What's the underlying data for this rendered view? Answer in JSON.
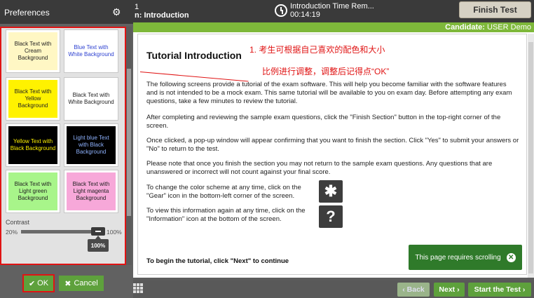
{
  "topbar": {
    "section_num": "1",
    "section_label": "n: Introduction",
    "timer_label": "Introduction Time Rem...",
    "timer_value": "00:14:19",
    "finish_label": "Finish Test"
  },
  "candidate": {
    "label": "Candidate:",
    "name": "USER Demo"
  },
  "main": {
    "title": "Tutorial Introduction",
    "p1": "The following screens provide a tutorial of the exam software. This will help you become familiar with the software features and is not intended to be a mock exam. This same tutorial will be available to you on exam day. Before attempting any exam questions, take a few minutes to review the tutorial.",
    "p2": "After completing and reviewing the sample exam questions, click the \"Finish Section\" button in the top-right corner of the screen.",
    "p3": "Once clicked, a pop-up window will appear confirming that you want to finish the section. Click \"Yes\" to submit your answers or \"No\" to return to the test.",
    "p4": "Please note that once you finish the section you may not return to the sample exam questions. Any questions that are unanswered or incorrect will not count against your final score.",
    "gear_text": "To change the color scheme at any time, click on the \"Gear\" icon in the bottom-left corner of the screen.",
    "info_text": "To view this information again at any time, click on the \"Information\" icon at the bottom of the screen.",
    "begin_text": "To begin the tutorial, click \"Next\" to continue",
    "scroll_tip": "This page requires scrolling"
  },
  "annotation": {
    "line1": "1.  考生可根据自己喜欢的配色和大小",
    "line2": "比例进行调整，调整后记得点“OK”"
  },
  "prefs": {
    "title": "Preferences",
    "swatches": [
      {
        "text": "Black Text with Cream Background",
        "fg": "#222222",
        "bg": "#fff7c4"
      },
      {
        "text": "Blue Text with White Background",
        "fg": "#2b3fd0",
        "bg": "#ffffff"
      },
      {
        "text": "Black Text with Yellow Background",
        "fg": "#222222",
        "bg": "#fff200"
      },
      {
        "text": "Black Text with White Background",
        "fg": "#222222",
        "bg": "#ffffff"
      },
      {
        "text": "Yellow Text with Black Background",
        "fg": "#fff200",
        "bg": "#000000"
      },
      {
        "text": "Light blue Text with Black Background",
        "fg": "#8fb3ff",
        "bg": "#000000"
      },
      {
        "text": "Black Text with Light green Background",
        "fg": "#222222",
        "bg": "#a8f58a"
      },
      {
        "text": "Black Text with Light magenta Background",
        "fg": "#222222",
        "bg": "#f7a8d9"
      }
    ],
    "contrast_label": "Contrast",
    "contrast_min": "20%",
    "contrast_max": "100%",
    "contrast_value": "100%",
    "contrast_level": 1.0,
    "ok_label": "OK",
    "cancel_label": "Cancel"
  },
  "nav": {
    "back": "Back",
    "next": "Next",
    "start": "Start the Test"
  }
}
